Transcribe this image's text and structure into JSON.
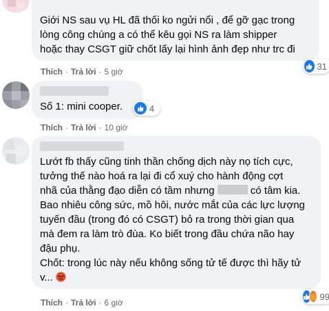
{
  "comments": [
    {
      "text": "Giới NS sau vụ HL đã thối ko ngửi nổi , để gỡ gạc trong\nlòng công chúng a có thể kêu gọi NS ra làm shipper\nhoặc thay CSGT giữ chốt lấy lại hình ảnh đẹp như trc đi",
      "reaction_count": "31",
      "like_label": "Thích",
      "reply_label": "Trả lời",
      "time": "5 giờ"
    },
    {
      "text": "Số 1: mini cooper.",
      "reaction_count": "4",
      "like_label": "Thích",
      "reply_label": "Trả lời",
      "time": "10 giờ"
    },
    {
      "text_a": "Lướt fb thấy cũng tinh thần chống dịch này nọ tích cực,\ntưởng thế nào hoá ra lại đi cổ xuý cho hành động cợt\nnhã của thằng đạo diễn có tầm nhưng ",
      "text_b": " có tâm kia.\nBao nhiêu công sức, mồ hôi, nước mắt của các lực lượng\ntuyến đầu (trong đó có CSGT) bỏ ra trong thời gian qua\nmà đem ra làm trò đùa. Ko biết trong đầu chứa não hay\nđậu phụ.\nChốt: trong lúc này nếu không sống tử tế được thì hãy tử\nv...",
      "reaction_count": "99",
      "like_label": "Thích",
      "reply_label": "Trả lời",
      "time": "6 giờ"
    }
  ],
  "colors": {
    "bubble": "#f0f2f5",
    "meta": "#65676b",
    "like": "#1877f2"
  },
  "icons": [
    "like-reaction-icon",
    "angry-reaction-icon"
  ]
}
